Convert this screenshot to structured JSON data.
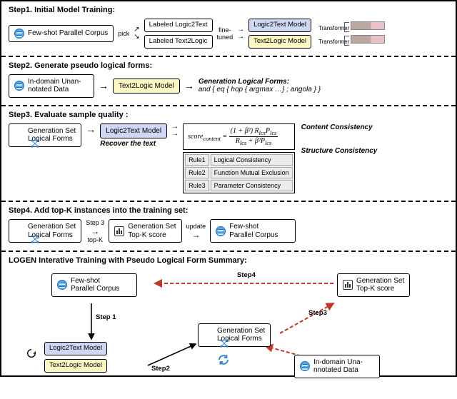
{
  "step1": {
    "title": "Step1. Initial Model Training:",
    "db_label": "Few-shot Parallel Corpus",
    "pick": "pick",
    "labeled_l2t": "Labeled Logic2Text",
    "labeled_t2l": "Labeled Text2Logic",
    "fine_tuned": "fine-\ntuned",
    "model_l2t": "Logic2Text Model",
    "model_t2l": "Text2Logic Model",
    "transformer": "Transformer"
  },
  "step2": {
    "title": "Step2. Generate pseudo logical forms:",
    "db_label": "In-domain Unan-\nnotated Data",
    "model_t2l": "Text2Logic Model",
    "gen_title": "Generation Logical Forms:",
    "gen_example": "and { eq { hop { argmax …} ; angola } }"
  },
  "step3": {
    "title": "Step3. Evaluate sample quality :",
    "gen_set": "Generation Set\nLogical Forms",
    "model_l2t": "Logic2Text Model",
    "recover": "Recover the text",
    "formula": "score_content = ((1 + β²) R_lcs P_lcs) / (R_lcs + β² P_lcs)",
    "content_cons": "Content Consistency",
    "rule1": "Rule1",
    "rule1v": "Logical Consistency",
    "rule2": "Rule2",
    "rule2v": "Function Mutual Exclusion",
    "rule3": "Rule3",
    "rule3v": "Parameter Consistency",
    "struct_cons": "Structure Consistency"
  },
  "step4": {
    "title": "Step4. Add top-K instances into the training set:",
    "gen_set": "Generation Set\nLogical Forms",
    "step3_lbl": "Step 3",
    "topk_lbl": "top-K",
    "gen_topk": "Generation Set\nTop-K score",
    "update": "update",
    "db_label": "Few-shot\nParallel Corpus"
  },
  "summary": {
    "title": "LOGEN Interative Training with Pseudo Logical Form Summary:",
    "db_label": "Few-shot\nParallel Corpus",
    "model_l2t": "Logic2Text Model",
    "model_t2l": "Text2Logic Model",
    "gen_set": "Generation Set\nLogical Forms",
    "gen_topk": "Generation Set\nTop-K score",
    "indomain": "In-domain Una-\nnnotated Data",
    "step1_lbl": "Step 1",
    "step2_lbl": "Step2",
    "step3_lbl": "Step3",
    "step4_lbl": "Step4"
  }
}
